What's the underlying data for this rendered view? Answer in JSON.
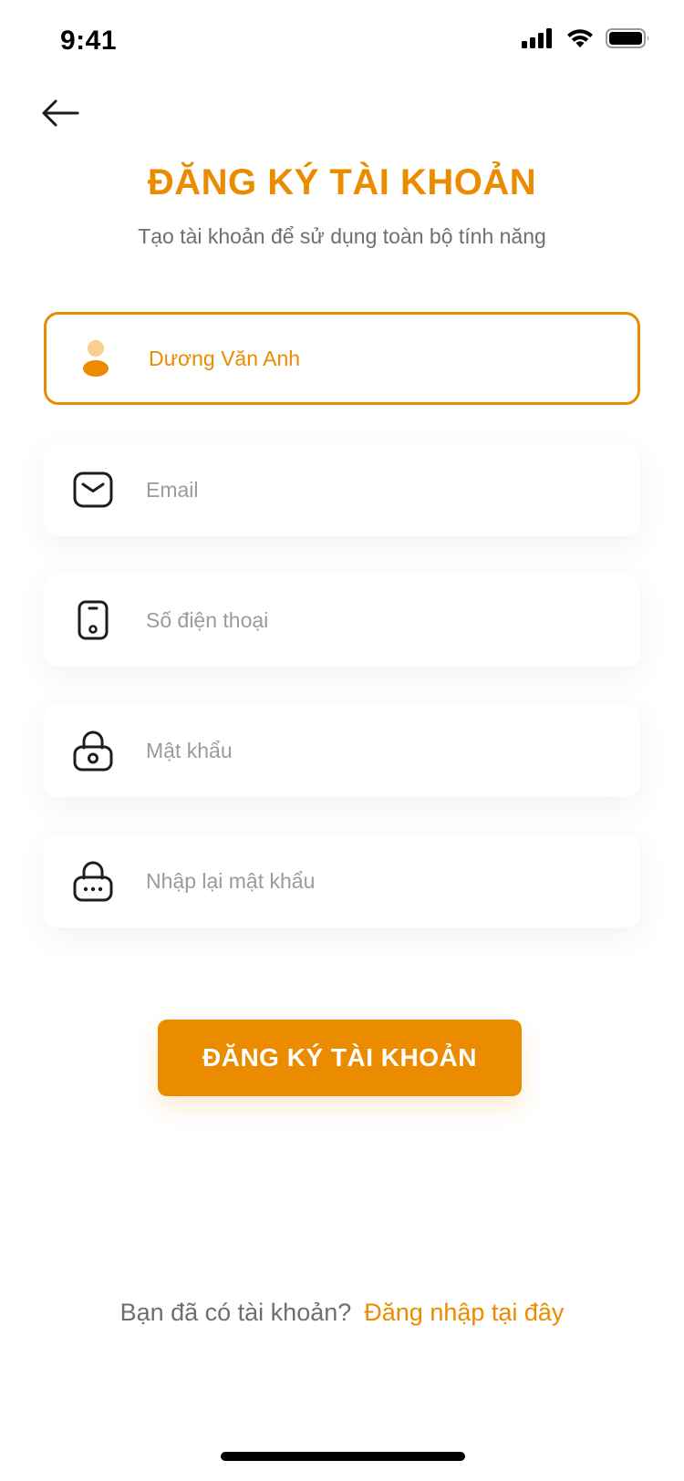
{
  "status_bar": {
    "time": "9:41"
  },
  "header": {
    "title": "ĐĂNG KÝ TÀI KHOẢN",
    "subtitle": "Tạo tài khoản để sử dụng toàn bộ tính năng"
  },
  "form": {
    "name": {
      "value": "Dương Văn Anh",
      "icon": "user-icon"
    },
    "email": {
      "placeholder": "Email",
      "icon": "mail-icon"
    },
    "phone": {
      "placeholder": "Số điện thoại",
      "icon": "phone-icon"
    },
    "password": {
      "placeholder": "Mật khẩu",
      "icon": "lock-icon"
    },
    "confirm_password": {
      "placeholder": "Nhập lại mật khẩu",
      "icon": "lock-dots-icon"
    },
    "submit_label": "ĐĂNG KÝ TÀI KHOẢN"
  },
  "footer": {
    "text": "Bạn đã có tài khoản?",
    "link": "Đăng nhập tại đây"
  },
  "colors": {
    "accent": "#EA8B00",
    "text_muted": "#6E6E73",
    "placeholder": "#9A9A9F"
  }
}
